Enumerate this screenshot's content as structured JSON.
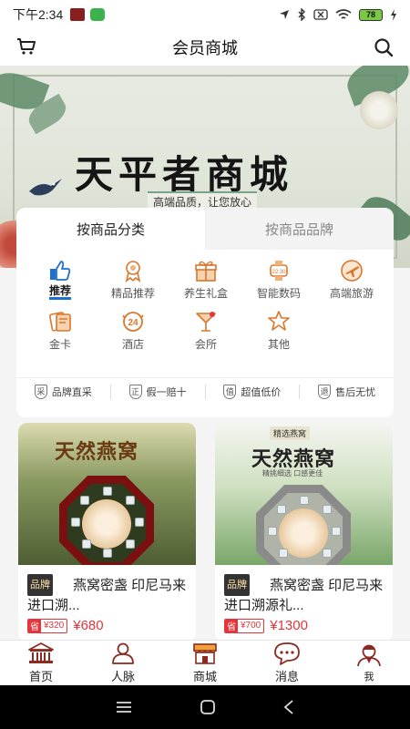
{
  "status_bar": {
    "time": "下午2:34",
    "battery": "78"
  },
  "header": {
    "title": "会员商城",
    "cart_icon": "cart-icon",
    "search_icon": "search-icon"
  },
  "banner": {
    "title": "天平者商城",
    "subtitle": "高端品质，让您放心"
  },
  "category_tabs": [
    {
      "label": "按商品分类",
      "active": true
    },
    {
      "label": "按商品品牌",
      "active": false
    }
  ],
  "categories": [
    {
      "label": "推荐",
      "icon": "thumbs-up-icon",
      "active": true
    },
    {
      "label": "精品推荐",
      "icon": "award-icon"
    },
    {
      "label": "养生礼盒",
      "icon": "gift-box-icon"
    },
    {
      "label": "智能数码",
      "icon": "smart-watch-icon"
    },
    {
      "label": "高端旅游",
      "icon": "airplane-icon"
    },
    {
      "label": "金卡",
      "icon": "gold-card-icon"
    },
    {
      "label": "酒店",
      "icon": "hotel-24h-icon"
    },
    {
      "label": "会所",
      "icon": "cocktail-icon"
    },
    {
      "label": "其他",
      "icon": "star-outline-icon"
    }
  ],
  "guarantees": [
    {
      "mark": "采",
      "label": "品牌直采"
    },
    {
      "mark": "正",
      "label": "假一赔十"
    },
    {
      "mark": "值",
      "label": "超值低价"
    },
    {
      "mark": "退",
      "label": "售后无忧"
    }
  ],
  "products": [
    {
      "image_title": "天然燕窝",
      "badge": "品牌",
      "name": "燕窝密盏 印尼马来进口溯...",
      "save_prefix": "省",
      "save_amount": "¥320",
      "price": "¥680"
    },
    {
      "image_tag": "精选燕窝",
      "image_title": "天然燕窝",
      "image_subtitle": "精挑细选 口感更佳",
      "badge": "品牌",
      "name": "燕窝密盏 印尼马来进口溯源礼...",
      "save_prefix": "省",
      "save_amount": "¥700",
      "price": "¥1300"
    }
  ],
  "bottom_nav": [
    {
      "label": "首页",
      "icon": "home-bank-icon"
    },
    {
      "label": "人脉",
      "icon": "contacts-icon"
    },
    {
      "label": "商城",
      "icon": "shop-icon",
      "active": true
    },
    {
      "label": "消息",
      "icon": "message-icon"
    },
    {
      "label": "我",
      "icon": "profile-icon"
    }
  ],
  "colors": {
    "accent_red": "#e6353a",
    "tab_underline": "#1d6fd1",
    "icon_orange": "#d9772c"
  }
}
